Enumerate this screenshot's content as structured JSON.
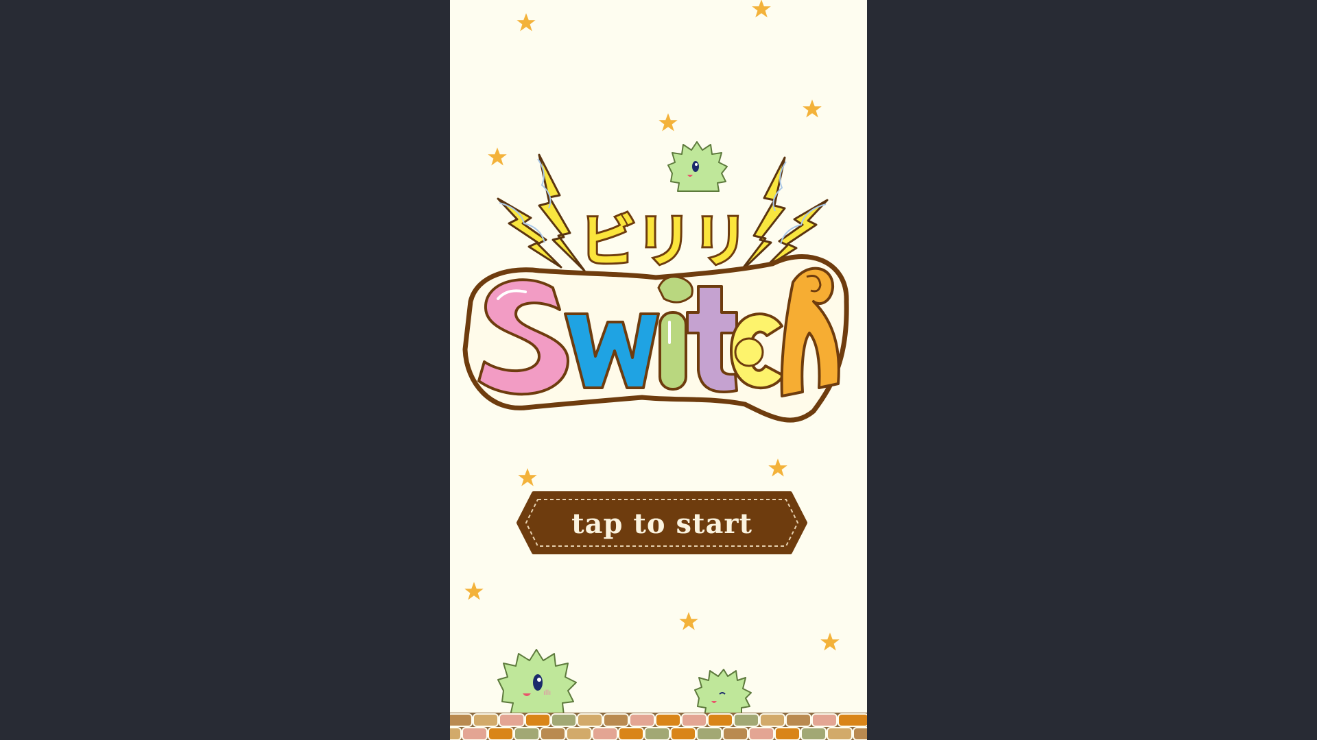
{
  "game": {
    "title_kana": "ビリリ",
    "title_main": "Switch",
    "start_button_label": "tap to start"
  },
  "colors": {
    "side_background": "#282b34",
    "play_background": "#fefdf0",
    "button_fill": "#6e3c0e",
    "button_text": "#fbf3df",
    "star": "#f3b23a",
    "letter_s": "#f29cc4",
    "letter_w": "#1fa3e3",
    "letter_i": "#b9d77f",
    "letter_t": "#c5a2d0",
    "letter_c": "#fdf36c",
    "letter_h": "#f6ad33",
    "bolt": "#f9e63f",
    "critter": "#bfe79a"
  },
  "icons": [
    "star-icon",
    "lightning-bolt-icon",
    "fuzzy-critter-character",
    "brick-ground"
  ]
}
